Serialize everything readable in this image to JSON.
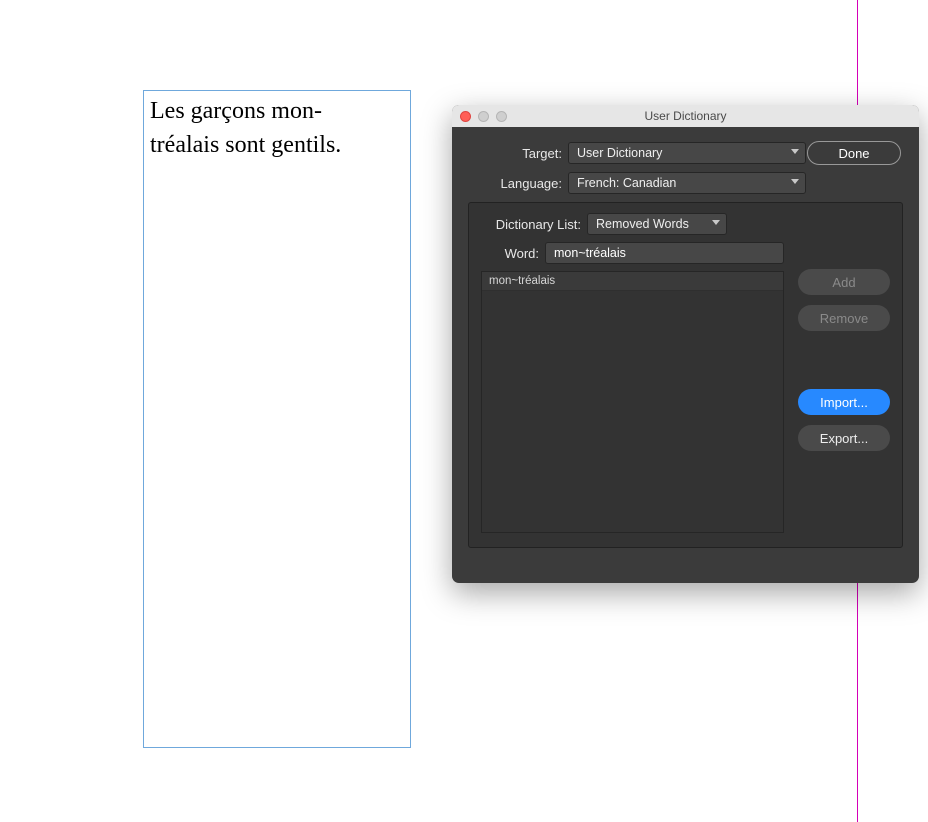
{
  "textFrame": {
    "line1": "Les garçons mon-",
    "line2": "tréalais sont gentils."
  },
  "dialog": {
    "title": "User Dictionary",
    "target": {
      "label": "Target:",
      "value": "User Dictionary"
    },
    "language": {
      "label": "Language:",
      "value": "French: Canadian"
    },
    "dictionaryList": {
      "label": "Dictionary List:",
      "value": "Removed Words"
    },
    "word": {
      "label": "Word:",
      "value": "mon~tréalais"
    },
    "wordList": {
      "items": [
        "mon~tréalais"
      ]
    },
    "buttons": {
      "done": "Done",
      "add": "Add",
      "remove": "Remove",
      "import": "Import...",
      "export": "Export..."
    }
  }
}
